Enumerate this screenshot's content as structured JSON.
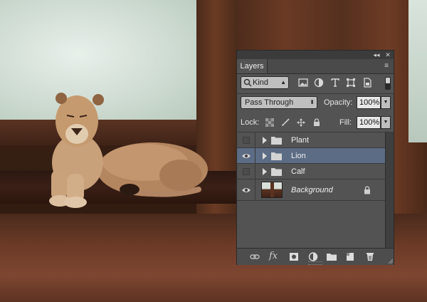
{
  "panel": {
    "tab_label": "Layers",
    "collapse_glyph": "◂◂",
    "close_glyph": "✕",
    "menu_glyph": "≡"
  },
  "filter": {
    "kind_label": "Kind",
    "icons": [
      "image-filter-icon",
      "adjustment-filter-icon",
      "type-filter-icon",
      "shape-filter-icon",
      "smart-object-filter-icon"
    ]
  },
  "blend": {
    "mode": "Pass Through",
    "opacity_label": "Opacity:",
    "opacity_value": "100%"
  },
  "lock": {
    "label": "Lock:",
    "fill_label": "Fill:",
    "fill_value": "100%"
  },
  "layers": [
    {
      "name": "Plant",
      "type": "group",
      "visible": false,
      "selected": false
    },
    {
      "name": "Lion",
      "type": "group",
      "visible": true,
      "selected": true
    },
    {
      "name": "Calf",
      "type": "group",
      "visible": false,
      "selected": false
    },
    {
      "name": "Background",
      "type": "image",
      "visible": true,
      "selected": false,
      "locked": true
    }
  ],
  "bottom_bar": {
    "fx_label": "fx",
    "icons": [
      "link-layers-icon",
      "add-style-icon",
      "add-mask-icon",
      "new-adjustment-icon",
      "new-group-icon",
      "new-layer-icon",
      "delete-layer-icon"
    ]
  },
  "colors": {
    "panel_bg": "#535353",
    "selected_row": "#5c6c85"
  }
}
